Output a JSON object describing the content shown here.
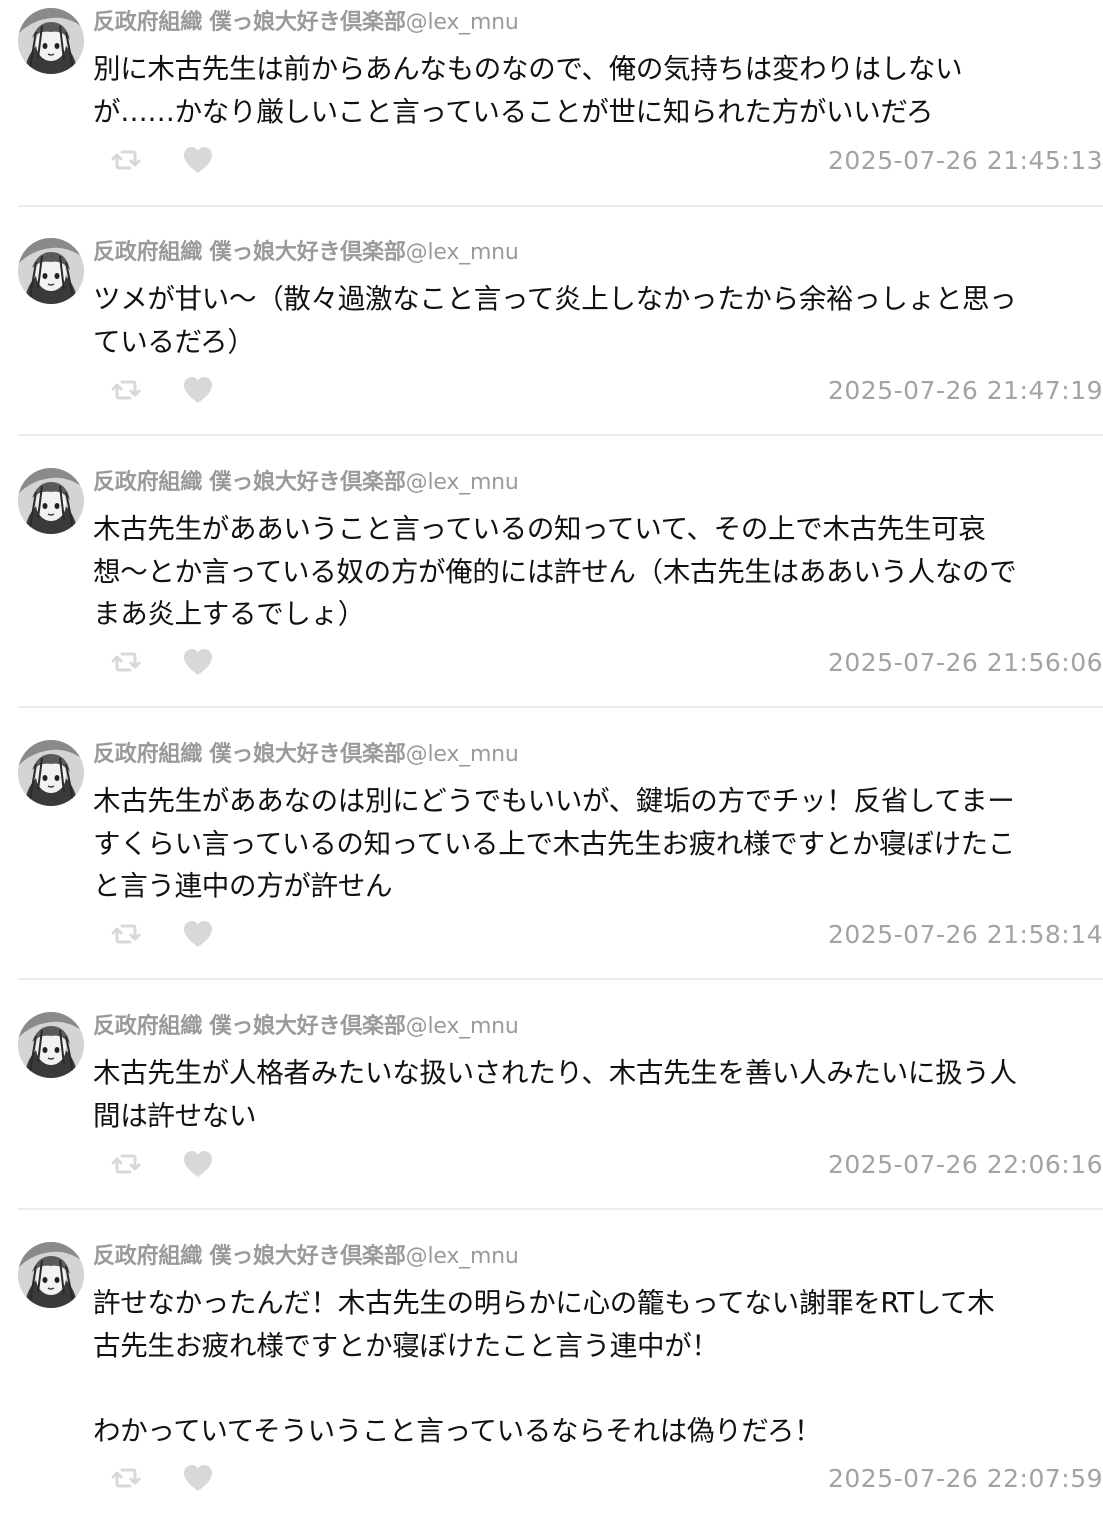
{
  "author": {
    "display_name": "反政府組織 僕っ娘大好き倶楽部",
    "handle": "@lex_mnu",
    "avatar_icon": "avatar-illustration-icon"
  },
  "colors": {
    "meta_text": "#9a9a9a",
    "body_text": "#111111",
    "timestamp": "#a3a3a3",
    "icon": "#d8d8d8",
    "divider": "#ececec"
  },
  "icons": {
    "retweet": "retweet-icon",
    "like": "heart-icon"
  },
  "posts": [
    {
      "lines": [
        "別に木古先生は前からあんなものなので、俺の気持ちは変わりはしない",
        "が……かなり厳しいこと言っていることが世に知られた方がいいだろ"
      ],
      "timestamp": "2025-07-26 21:45:13"
    },
    {
      "lines": [
        "ツメが甘い〜（散々過激なこと言って炎上しなかったから余裕っしょと思っ",
        "ているだろ）"
      ],
      "timestamp": "2025-07-26 21:47:19"
    },
    {
      "lines": [
        "木古先生がああいうこと言っているの知っていて、その上で木古先生可哀",
        "想〜とか言っている奴の方が俺的には許せん（木古先生はああいう人なので",
        "まあ炎上するでしょ）"
      ],
      "timestamp": "2025-07-26 21:56:06"
    },
    {
      "lines": [
        "木古先生がああなのは別にどうでもいいが、鍵垢の方でチッ！反省してまー",
        "すくらい言っているの知っている上で木古先生お疲れ様ですとか寝ぼけたこ",
        "と言う連中の方が許せん"
      ],
      "timestamp": "2025-07-26 21:58:14"
    },
    {
      "lines": [
        "木古先生が人格者みたいな扱いされたり、木古先生を善い人みたいに扱う人",
        "間は許せない"
      ],
      "timestamp": "2025-07-26 22:06:16"
    },
    {
      "lines": [
        "許せなかったんだ！木古先生の明らかに心の籠もってない謝罪をRTして木",
        "古先生お疲れ様ですとか寝ぼけたこと言う連中が！",
        "",
        "わかっていてそういうこと言っているならそれは偽りだろ！"
      ],
      "timestamp": "2025-07-26 22:07:59"
    }
  ]
}
